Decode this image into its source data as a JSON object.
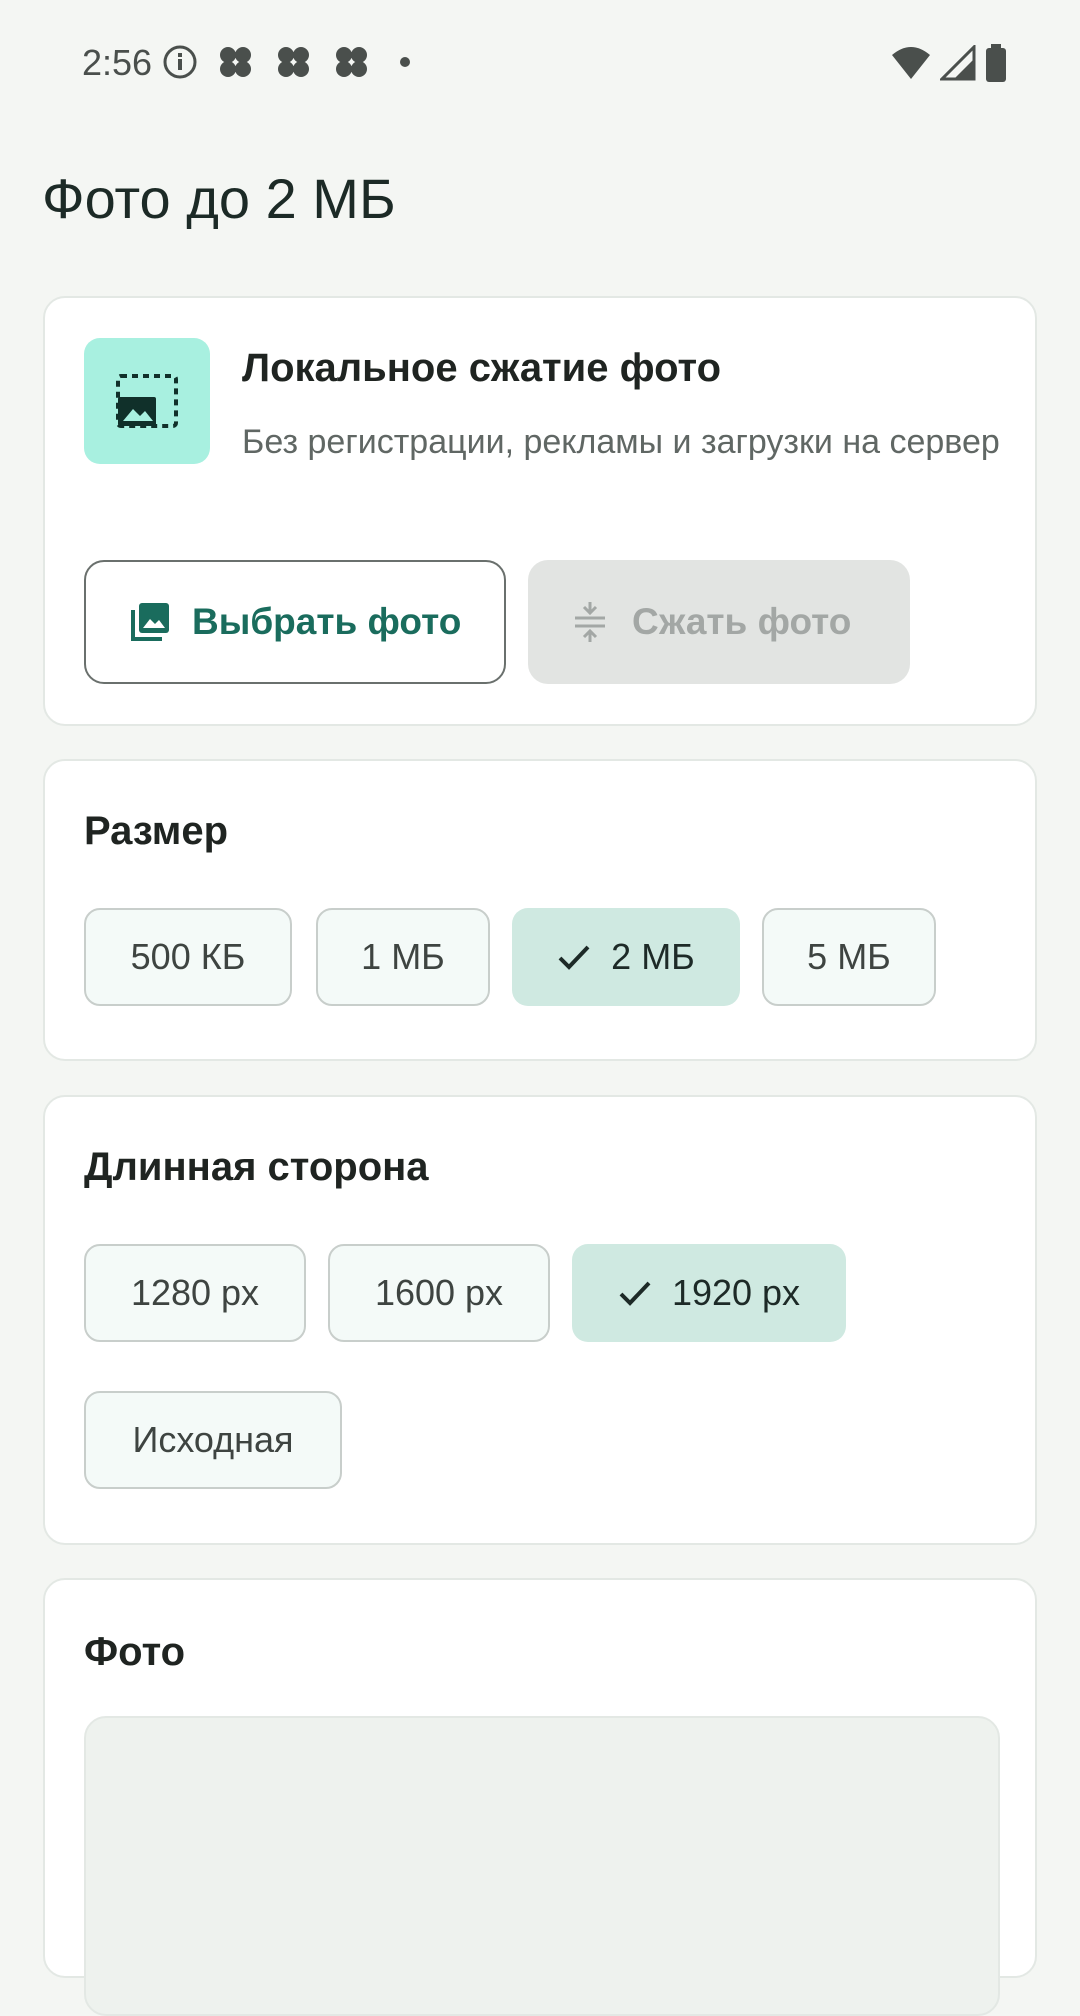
{
  "status_bar": {
    "time": "2:56",
    "left_icons": [
      "info-icon",
      "notification-icon",
      "notification-icon",
      "notification-icon",
      "dot-icon"
    ],
    "right_icons": [
      "wifi-icon",
      "signal-icon",
      "battery-icon"
    ]
  },
  "page": {
    "title": "Фото до 2 МБ"
  },
  "intro": {
    "icon": "photo-compress-icon",
    "title": "Локальное сжатие фото",
    "subtitle": "Без регистрации, рекламы и загрузки на сервер",
    "choose_button": "Выбрать фото",
    "choose_icon": "gallery-icon",
    "compress_button": "Сжать фото",
    "compress_icon": "compress-icon"
  },
  "size_section": {
    "title": "Размер",
    "options": [
      "500 КБ",
      "1 МБ",
      "2 МБ",
      "5 МБ"
    ],
    "selected": "2 МБ"
  },
  "side_section": {
    "title": "Длинная сторона",
    "options": [
      "1280 px",
      "1600 px",
      "1920 px",
      "Исходная"
    ],
    "selected": "1920 px"
  },
  "photo_section": {
    "title": "Фото"
  },
  "colors": {
    "background": "#f4f6f3",
    "accent": "#1a6c5d",
    "icon_tile": "#a8f0e0",
    "chip_selected": "#cfe9e1"
  }
}
